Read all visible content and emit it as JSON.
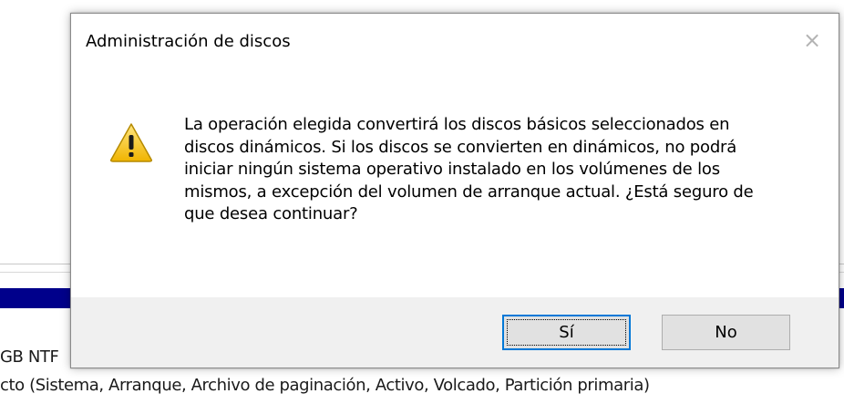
{
  "background": {
    "line1": "GB NTF",
    "line2": "cto (Sistema, Arranque, Archivo de paginación, Activo, Volcado, Partición primaria)"
  },
  "dialog": {
    "title": "Administración de discos",
    "close_icon": "×",
    "icon": "warning-icon",
    "message": "La operación elegida convertirá los discos básicos seleccionados en discos dinámicos. Si los discos se convierten en dinámicos, no podrá iniciar ningún sistema operativo instalado en los volúmenes de los mismos, a excepción del volumen de arranque actual. ¿Está seguro de que desea continuar?",
    "buttons": {
      "yes": "Sí",
      "no": "No"
    }
  },
  "colors": {
    "accent": "#0078d7",
    "background_bar": "#00008b",
    "footer": "#f0f0f0",
    "warning_fill": "#f5c518"
  }
}
